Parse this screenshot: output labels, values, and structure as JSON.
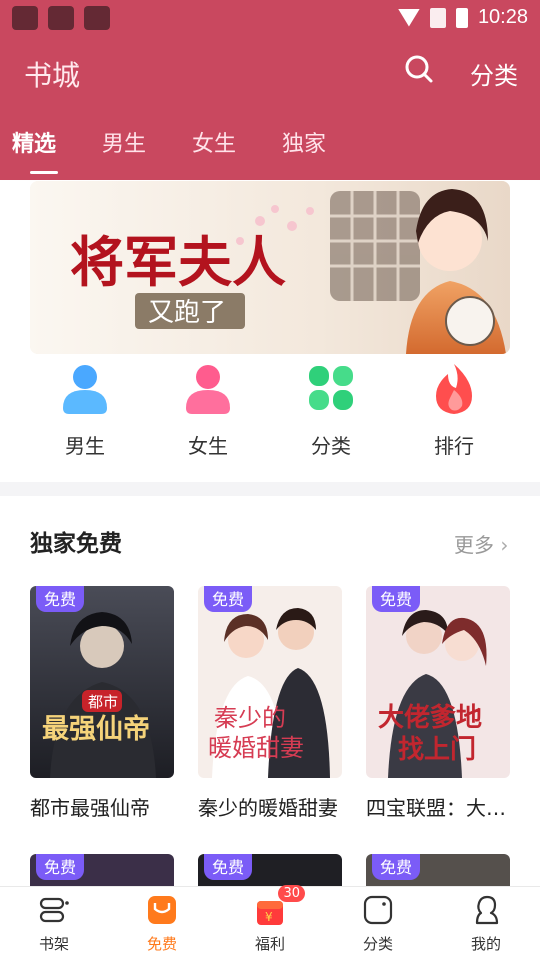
{
  "status_bar": {
    "time": "10:28"
  },
  "header": {
    "title": "书城",
    "search_icon": "search-icon",
    "classify_label": "分类",
    "tabs": [
      {
        "label": "精选",
        "active": true
      },
      {
        "label": "男生",
        "active": false
      },
      {
        "label": "女生",
        "active": false
      },
      {
        "label": "独家",
        "active": false
      }
    ]
  },
  "banner": {
    "title": "将军夫人",
    "subtitle": "又跑了"
  },
  "quick_categories": [
    {
      "label": "男生",
      "icon": "person-icon",
      "color": "#4aa8ff"
    },
    {
      "label": "女生",
      "icon": "person-icon",
      "color": "#ff5c8e"
    },
    {
      "label": "分类",
      "icon": "clover-icon",
      "color": "#2fd07a"
    },
    {
      "label": "排行",
      "icon": "flame-icon",
      "color": "#ff4e4e"
    }
  ],
  "section": {
    "title": "独家免费",
    "more_label": "更多",
    "books": [
      {
        "title": "都市最强仙帝",
        "badge": "免费",
        "cover_text": "都市 最强仙帝"
      },
      {
        "title": "秦少的暖婚甜妻",
        "badge": "免费",
        "cover_text": "秦少的暖婚甜妻"
      },
      {
        "title": "四宝联盟：大佬爹地找上门",
        "badge": "免费",
        "cover_text": "大佬爹地找上门"
      }
    ],
    "books_row2_badges": [
      "免费",
      "免费",
      "免费"
    ]
  },
  "bottom_nav": [
    {
      "label": "书架",
      "icon": "bookshelf-icon",
      "active": false
    },
    {
      "label": "免费",
      "icon": "free-icon",
      "active": true
    },
    {
      "label": "福利",
      "icon": "gift-icon",
      "active": false,
      "badge": "30"
    },
    {
      "label": "分类",
      "icon": "category-icon",
      "active": false
    },
    {
      "label": "我的",
      "icon": "profile-icon",
      "active": false
    }
  ],
  "colors": {
    "header_bg": "#c9485f",
    "active_tab": "#ff7a1c",
    "badge_bg": "#7b5cf7"
  }
}
